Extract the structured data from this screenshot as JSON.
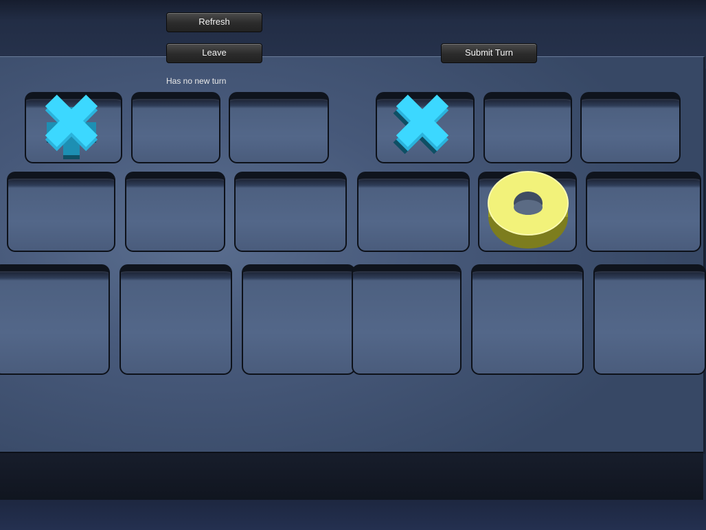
{
  "toolbar": {
    "refresh_label": "Refresh",
    "leave_label": "Leave",
    "submit_label": "Submit Turn"
  },
  "status": {
    "text": "Has no new turn"
  },
  "boards": [
    {
      "name": "left",
      "cells": [
        [
          "X",
          "",
          ""
        ],
        [
          "",
          "",
          ""
        ],
        [
          "",
          "",
          ""
        ]
      ]
    },
    {
      "name": "right",
      "cells": [
        [
          "X",
          "",
          ""
        ],
        [
          "",
          "O",
          ""
        ],
        [
          "",
          "",
          ""
        ]
      ]
    }
  ],
  "colors": {
    "x_piece": "#38d6ff",
    "o_piece": "#f3f37a",
    "board": "#4a5c7c"
  },
  "icons": {
    "x": "cross-piece-icon",
    "o": "ring-piece-icon"
  }
}
